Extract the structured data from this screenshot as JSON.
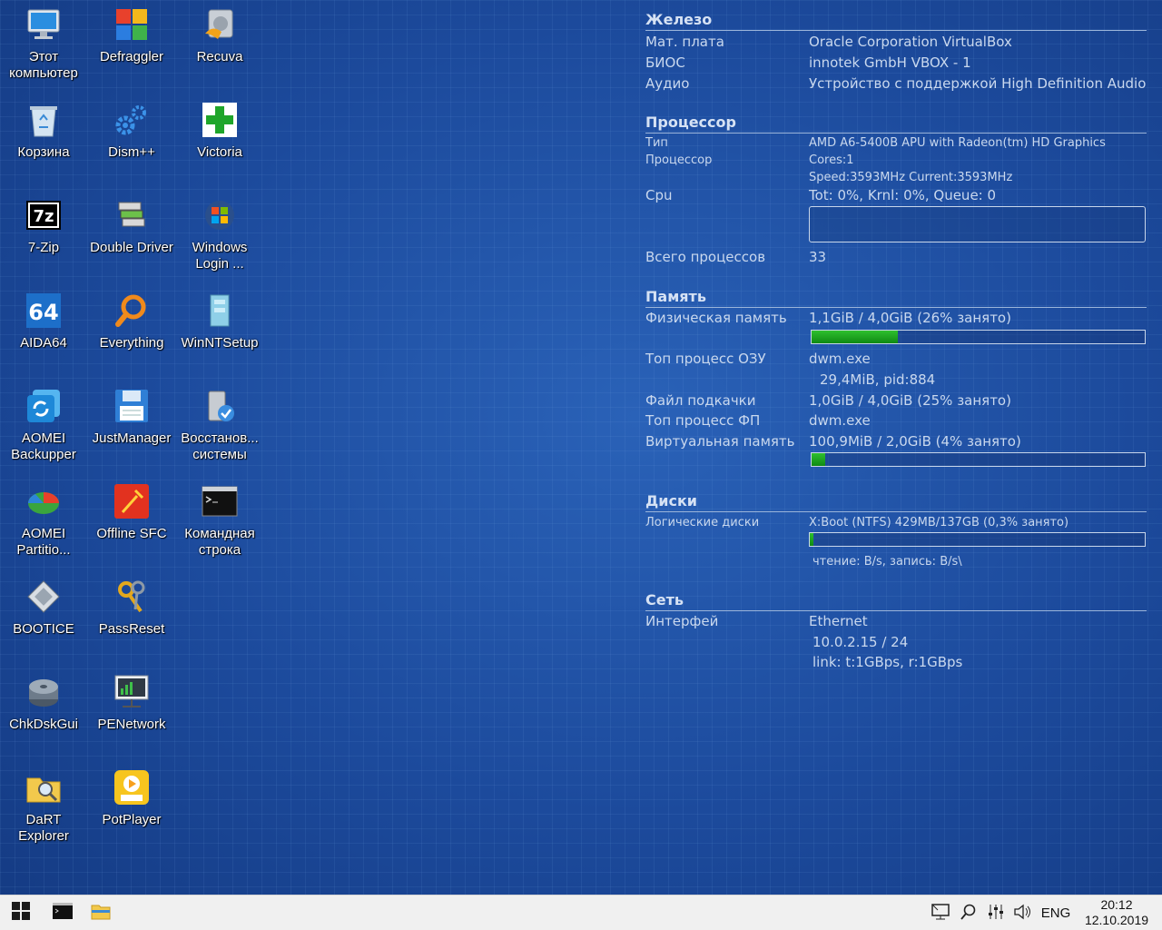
{
  "desktop": {
    "icons": [
      {
        "label": "Этот\nкомпьютер",
        "icon": "this-pc-icon"
      },
      {
        "label": "Defraggler",
        "icon": "defraggler-icon"
      },
      {
        "label": "Recuva",
        "icon": "recuva-icon"
      },
      {
        "label": "Корзина",
        "icon": "recycle-bin-icon"
      },
      {
        "label": "Dism++",
        "icon": "dism-gears-icon"
      },
      {
        "label": "Victoria",
        "icon": "victoria-cross-icon"
      },
      {
        "label": "7-Zip",
        "icon": "seven-zip-icon"
      },
      {
        "label": "Double Driver",
        "icon": "double-driver-icon"
      },
      {
        "label": "Windows\nLogin ...",
        "icon": "windows-login-icon"
      },
      {
        "label": "AIDA64",
        "icon": "aida64-icon"
      },
      {
        "label": "Everything",
        "icon": "everything-magnifier-icon"
      },
      {
        "label": "WinNTSetup",
        "icon": "winntsetup-icon"
      },
      {
        "label": "AOMEI\nBackupper",
        "icon": "aomei-backupper-icon"
      },
      {
        "label": "JustManager",
        "icon": "justmanager-floppy-icon"
      },
      {
        "label": "Восстанов...\nсистемы",
        "icon": "system-restore-icon"
      },
      {
        "label": "AOMEI\nPartitio...",
        "icon": "aomei-partition-icon"
      },
      {
        "label": "Offline SFC",
        "icon": "offline-sfc-icon"
      },
      {
        "label": "Командная\nстрока",
        "icon": "command-prompt-icon"
      },
      {
        "label": "BOOTICE",
        "icon": "bootice-icon"
      },
      {
        "label": "PassReset",
        "icon": "passreset-keys-icon"
      },
      {
        "label": "ChkDskGui",
        "icon": "chkdskgui-disk-icon"
      },
      {
        "label": "PENetwork",
        "icon": "penetwork-monitor-icon"
      },
      {
        "label": "DaRT\nExplorer",
        "icon": "dart-explorer-icon"
      },
      {
        "label": "PotPlayer",
        "icon": "potplayer-icon"
      }
    ]
  },
  "monitor": {
    "hardware": {
      "title": "Железо",
      "board_label": "Мат. плата",
      "board_value": "Oracle Corporation VirtualBox",
      "bios_label": "БИОС",
      "bios_value": "innotek GmbH VBOX  - 1",
      "audio_label": "Аудио",
      "audio_value": "Устройство с поддержкой High Definition Audio"
    },
    "cpu": {
      "title": "Процессор",
      "type_label": "Тип",
      "type_value": "AMD A6-5400B APU with Radeon(tm) HD Graphics",
      "proc_label": "Процессор",
      "cores_value": "Cores:1",
      "speed_value": "Speed:3593MHz   Current:3593MHz",
      "cpu_label": "Cpu",
      "cpu_value": "Tot:  0%, Krnl:  0%, Queue: 0",
      "total_label": "Всего процессов",
      "total_value": "33"
    },
    "memory": {
      "title": "Память",
      "phys_label": "Физическая память",
      "phys_value": "1,1GiB / 4,0GiB (26% занято)",
      "phys_used_fraction": 0.26,
      "top_ram_label": "Топ процесс ОЗУ",
      "top_ram_value": "dwm.exe",
      "top_ram_detail": "29,4MiB, pid:884",
      "page_label": "Файл подкачки",
      "page_value": "1,0GiB / 4,0GiB (25% занято)",
      "top_pf_label": "Топ процесс ФП",
      "top_pf_value": "dwm.exe",
      "virt_label": "Виртуальная память",
      "virt_value": "100,9MiB / 2,0GiB (4% занято)",
      "virt_used_fraction": 0.04
    },
    "disks": {
      "title": "Диски",
      "logical_label": "Логические диски",
      "logical_value": "X:Boot (NTFS) 429MB/137GB (0,3% занято)",
      "disk_used_fraction": 0.003,
      "io_value": "чтение: B/s, запись: B/s\\"
    },
    "network": {
      "title": "Сеть",
      "iface_label": "Интерфей",
      "iface_value": "Ethernet",
      "ip_value": "10.0.2.15 / 24",
      "link_value": "link: t:1GBps, r:1GBps"
    }
  },
  "taskbar": {
    "start_icon": "windows-start-icon",
    "pinned": [
      "command-prompt-icon",
      "file-explorer-icon"
    ],
    "tray": [
      "network-monitor-icon",
      "search-icon",
      "mixer-sliders-icon",
      "speaker-icon"
    ],
    "lang": "ENG",
    "time": "20:12",
    "date": "12.10.2019"
  },
  "colors": {
    "desktop_bg": "#1f4fa0",
    "bar_fill": "#1ea81e",
    "taskbar_bg": "#f0f0f0"
  }
}
